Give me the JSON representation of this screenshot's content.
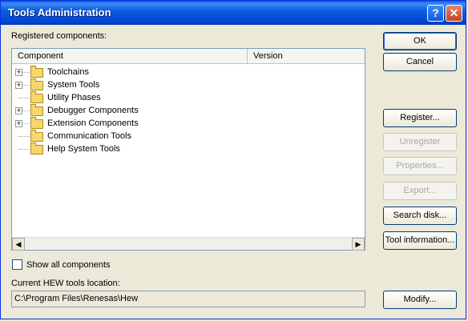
{
  "window": {
    "title": "Tools Administration",
    "help_glyph": "?",
    "close_glyph": "✕"
  },
  "registered_label": "Registered components:",
  "list": {
    "columns": [
      "Component",
      "Version"
    ],
    "items": [
      {
        "label": "Toolchains",
        "expandable": true
      },
      {
        "label": "System Tools",
        "expandable": true
      },
      {
        "label": "Utility Phases",
        "expandable": false
      },
      {
        "label": "Debugger Components",
        "expandable": true
      },
      {
        "label": "Extension Components",
        "expandable": true
      },
      {
        "label": "Communication Tools",
        "expandable": false
      },
      {
        "label": "Help System Tools",
        "expandable": false
      }
    ],
    "scroll_left_glyph": "◀",
    "scroll_right_glyph": "▶"
  },
  "buttons": {
    "ok": "OK",
    "cancel": "Cancel",
    "register": "Register...",
    "unregister": "Unregister",
    "properties": "Properties...",
    "export": "Export...",
    "search_disk": "Search disk...",
    "tool_information": "Tool information...",
    "modify": "Modify..."
  },
  "show_all": {
    "label": "Show all components",
    "checked": false
  },
  "location": {
    "label": "Current HEW tools location:",
    "value": "C:\\Program Files\\Renesas\\Hew"
  }
}
